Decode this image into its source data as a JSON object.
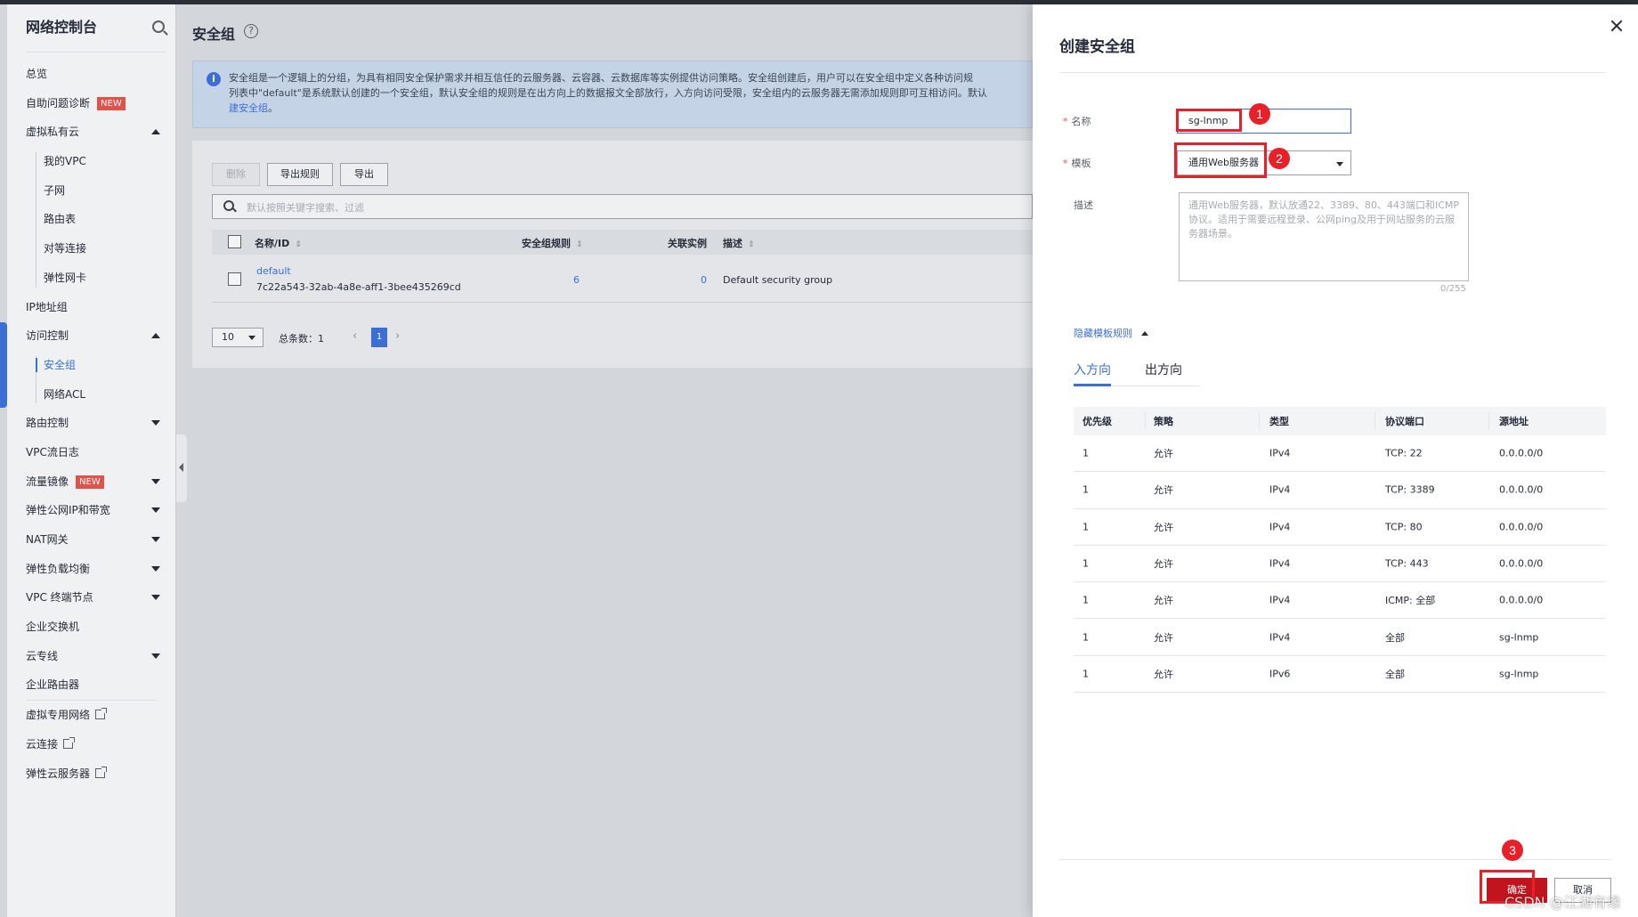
{
  "colors": {
    "accent": "#3b6fd6",
    "primary_button": "#c2141c",
    "badge_new": "#e2524a",
    "annotation": "#e8202a"
  },
  "sidebar": {
    "title": "网络控制台",
    "items": [
      {
        "label": "总览"
      },
      {
        "label": "自助问题诊断",
        "badge": "NEW"
      },
      {
        "label": "虚拟私有云",
        "caret": "up"
      },
      {
        "label": "我的VPC",
        "sub": true
      },
      {
        "label": "子网",
        "sub": true
      },
      {
        "label": "路由表",
        "sub": true
      },
      {
        "label": "对等连接",
        "sub": true
      },
      {
        "label": "弹性网卡",
        "sub": true
      },
      {
        "label": "IP地址组"
      },
      {
        "label": "访问控制",
        "caret": "up"
      },
      {
        "label": "安全组",
        "sub": true,
        "active": true
      },
      {
        "label": "网络ACL",
        "sub": true
      },
      {
        "label": "路由控制",
        "caret": "down"
      },
      {
        "label": "VPC流日志"
      },
      {
        "label": "流量镜像",
        "badge": "NEW",
        "caret": "down"
      },
      {
        "label": "弹性公网IP和带宽",
        "caret": "down"
      },
      {
        "label": "NAT网关",
        "caret": "down"
      },
      {
        "label": "弹性负载均衡",
        "caret": "down"
      },
      {
        "label": "VPC 终端节点",
        "caret": "down"
      },
      {
        "label": "企业交换机"
      },
      {
        "label": "云专线",
        "caret": "down"
      },
      {
        "label": "企业路由器"
      },
      {
        "label": "虚拟专用网络",
        "external": true
      },
      {
        "label": "云连接",
        "external": true
      },
      {
        "label": "弹性云服务器",
        "external": true
      }
    ]
  },
  "main": {
    "title": "安全组",
    "info_line1": "安全组是一个逻辑上的分组，为具有相同安全保护需求并相互信任的云服务器、云容器、云数据库等实例提供访问策略。安全组创建后，用户可以在安全组中定义各种访问规",
    "info_line2": "列表中\"default\"是系统默认创建的一个安全组，默认安全组的规则是在出方向上的数据报文全部放行，入方向访问受限，安全组内的云服务器无需添加规则即可互相访问。默认",
    "info_link": "建安全组",
    "info_tail": "。",
    "buttons": {
      "delete": "删除",
      "export_rules": "导出规则",
      "export": "导出"
    },
    "search_placeholder": "默认按照关键字搜索、过滤",
    "columns": {
      "name": "名称/ID",
      "rules": "安全组规则",
      "instances": "关联实例",
      "desc": "描述"
    },
    "row": {
      "name": "default",
      "id": "7c22a543-32ab-4a8e-aff1-3bee435269cd",
      "rules": "6",
      "instances": "0",
      "desc": "Default security group"
    },
    "pagination": {
      "page_size": "10",
      "total": "总条数：1",
      "current": "1",
      "prev": "‹",
      "next": "›"
    }
  },
  "drawer": {
    "title": "创建安全组",
    "name_label": "名称",
    "name_value": "sg-lnmp",
    "template_label": "模板",
    "template_value": "通用Web服务器",
    "desc_label": "描述",
    "desc_placeholder": "通用Web服务器，默认放通22、3389、80、443端口和ICMP协议。适用于需要远程登录、公网ping及用于网站服务的云服务器场景。",
    "desc_count": "0/255",
    "hide_rules": "隐藏模板规则",
    "tabs": [
      "入方向",
      "出方向"
    ],
    "rule_columns": [
      "优先级",
      "策略",
      "类型",
      "协议端口",
      "源地址"
    ],
    "rules": [
      [
        "1",
        "允许",
        "IPv4",
        "TCP: 22",
        "0.0.0.0/0"
      ],
      [
        "1",
        "允许",
        "IPv4",
        "TCP: 3389",
        "0.0.0.0/0"
      ],
      [
        "1",
        "允许",
        "IPv4",
        "TCP: 80",
        "0.0.0.0/0"
      ],
      [
        "1",
        "允许",
        "IPv4",
        "TCP: 443",
        "0.0.0.0/0"
      ],
      [
        "1",
        "允许",
        "IPv4",
        "ICMP: 全部",
        "0.0.0.0/0"
      ],
      [
        "1",
        "允许",
        "IPv4",
        "全部",
        "sg-lnmp"
      ],
      [
        "1",
        "允许",
        "IPv6",
        "全部",
        "sg-lnmp"
      ]
    ],
    "ok": "确定",
    "cancel": "取消"
  },
  "annotations": {
    "step1": "1",
    "step2": "2",
    "step3": "3"
  },
  "watermark": "CSDN @江湖有缘"
}
